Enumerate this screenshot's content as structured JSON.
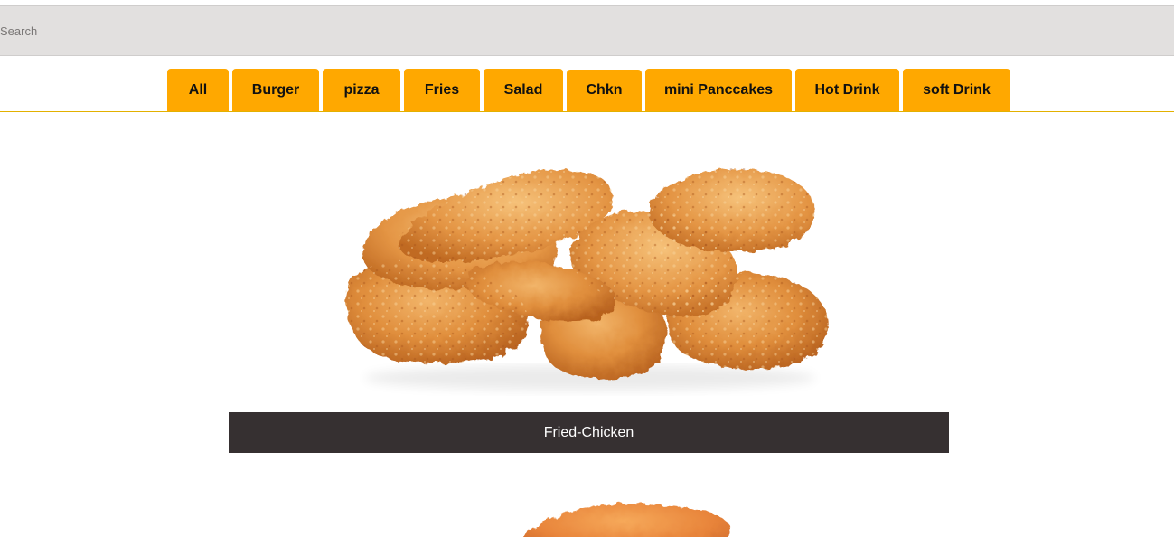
{
  "search": {
    "placeholder": "Search",
    "value": ""
  },
  "colors": {
    "tab_bg": "#ffa800",
    "tab_underline": "#e3b100",
    "search_bg": "#e2e0df",
    "caption_bg": "#363031"
  },
  "tabs": [
    {
      "label": "All"
    },
    {
      "label": "Burger"
    },
    {
      "label": "pizza"
    },
    {
      "label": "Fries"
    },
    {
      "label": "Salad"
    },
    {
      "label": "Chkn",
      "active": true
    },
    {
      "label": "mini Panccakes"
    },
    {
      "label": "Hot Drink"
    },
    {
      "label": "soft Drink"
    }
  ],
  "items": [
    {
      "name": "Fried-Chicken",
      "image": "fried-chicken-image"
    },
    {
      "name": "",
      "image": "fried-chicken-image"
    }
  ]
}
